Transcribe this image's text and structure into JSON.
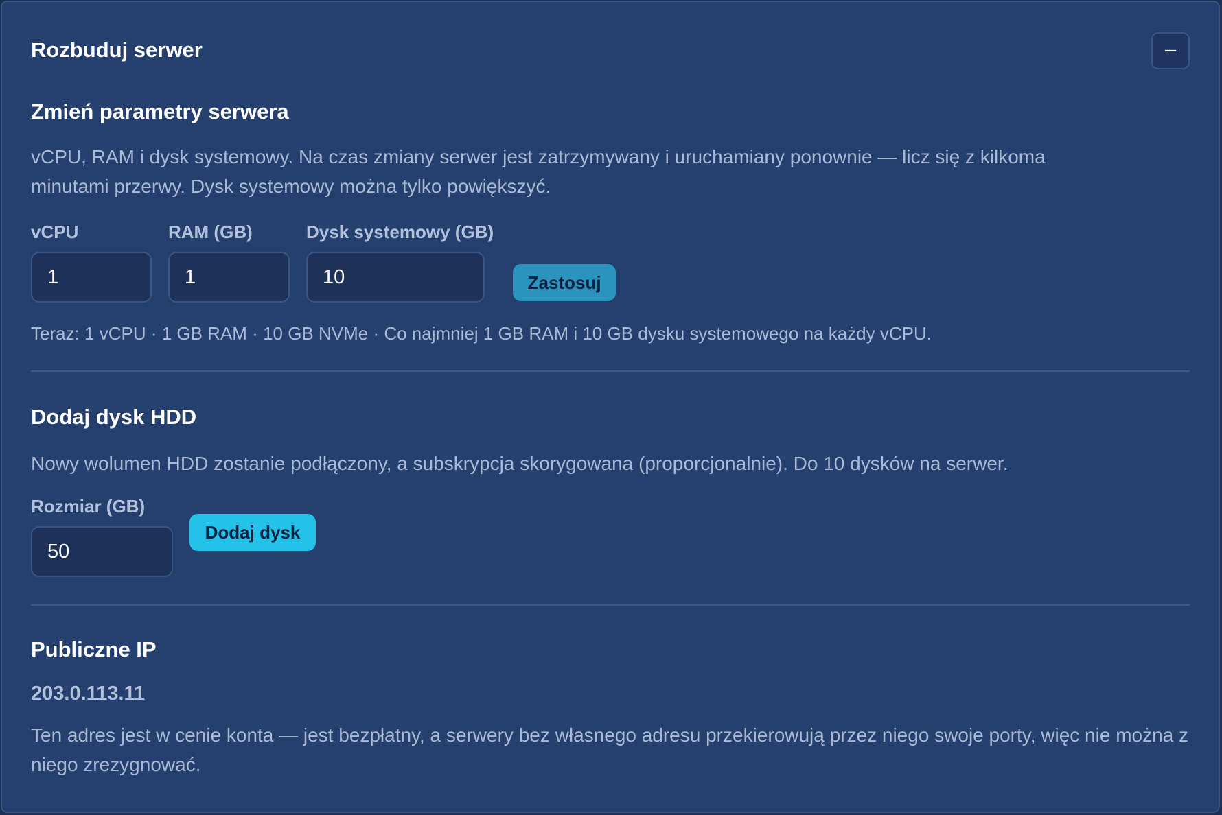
{
  "panel": {
    "title": "Rozbuduj serwer",
    "collapse_label": "−"
  },
  "resize": {
    "title": "Zmień parametry serwera",
    "description": "vCPU, RAM i dysk systemowy. Na czas zmiany serwer jest zatrzymywany i uruchamiany ponownie — licz się z kilkoma minutami przerwy. Dysk systemowy można tylko powiększyć.",
    "vcpu_label": "vCPU",
    "vcpu_value": "1",
    "ram_label": "RAM (GB)",
    "ram_value": "1",
    "disk_label": "Dysk systemowy (GB)",
    "disk_value": "10",
    "apply_label": "Zastosuj",
    "hint": "Teraz: 1 vCPU · 1 GB RAM · 10 GB NVMe · Co najmniej 1 GB RAM i 10 GB dysku systemowego na każdy vCPU."
  },
  "hdd": {
    "title": "Dodaj dysk HDD",
    "description": "Nowy wolumen HDD zostanie podłączony, a subskrypcja skorygowana (proporcjonalnie). Do 10 dysków na serwer.",
    "size_label": "Rozmiar (GB)",
    "size_value": "50",
    "add_label": "Dodaj dysk"
  },
  "public_ip": {
    "title": "Publiczne IP",
    "address": "203.0.113.11",
    "description": "Ten adres jest w cenie konta — jest bezpłatny, a serwery bez własnego adresu przekierowują przez niego swoje porty, więc nie można z niego zrezygnować."
  },
  "colors": {
    "background": "#253f6e",
    "apply_button": "#2a94bf",
    "add_button": "#24c2e8"
  }
}
